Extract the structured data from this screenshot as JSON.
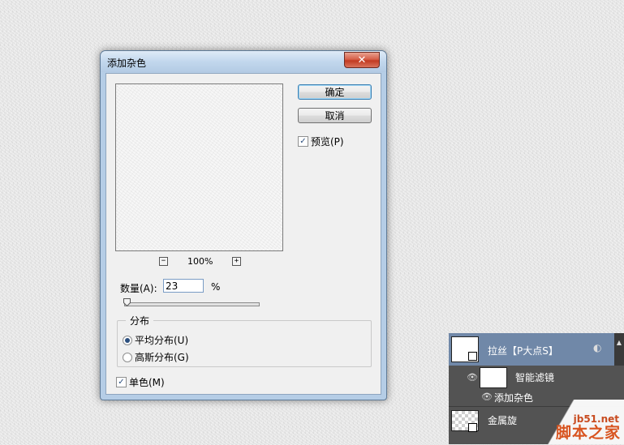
{
  "dialog": {
    "title": "添加杂色",
    "close_glyph": "✕",
    "ok_label": "确定",
    "cancel_label": "取消",
    "preview_label": "预览(P)",
    "preview_checked": true,
    "zoom_level": "100%",
    "zoom_out_glyph": "−",
    "zoom_in_glyph": "+",
    "amount_label": "数量(A):",
    "amount_value": "23",
    "amount_unit": "%",
    "amount_slider_fraction": 0.02,
    "distribution_title": "分布",
    "distribution_options": [
      {
        "label": "平均分布(U)",
        "selected": true
      },
      {
        "label": "高斯分布(G)",
        "selected": false
      }
    ],
    "monochrome_label": "单色(M)",
    "monochrome_checked": true
  },
  "layers_panel": {
    "layer_name": "拉丝【P大点S】",
    "smart_filters_label": "智能滤镜",
    "filter_item_label": "添加杂色",
    "second_layer_name": "金属旋",
    "eye_icon": "eye-icon"
  },
  "watermark": {
    "site": "jb51.net",
    "name": "脚本之家"
  },
  "colors": {
    "selected_layer": "#7088a8",
    "panel_bg": "#535353",
    "close_button": "#c23b22"
  }
}
